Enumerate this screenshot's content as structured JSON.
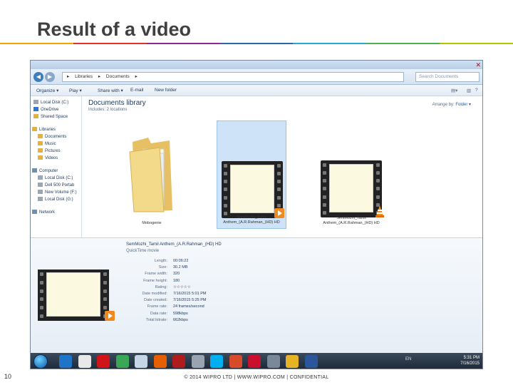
{
  "slide": {
    "title": "Result of a video",
    "page_number": "10",
    "footer": "© 2014 WIPRO LTD | WWW.WIPRO.COM | CONFIDENTIAL",
    "rule_colors": [
      "#f2a600",
      "#e0312b",
      "#8e2a8a",
      "#3064b0",
      "#2aa6d8",
      "#4caf50",
      "#b5c400"
    ]
  },
  "explorer": {
    "address": [
      "Libraries",
      "Documents"
    ],
    "search_placeholder": "Search Documents",
    "toolbar": {
      "organize": "Organize ▾",
      "play": "Play ▾",
      "share": "Share with ▾",
      "email": "E-mail",
      "new_folder": "New folder"
    },
    "nav": [
      {
        "label": "Local Disk (C:)",
        "color": "#9aa6b2"
      },
      {
        "label": "OneDrive",
        "color": "#2a78d0"
      },
      {
        "label": "Shared Space",
        "color": "#e3b13c"
      },
      {
        "label": "Libraries",
        "color": "#e3b13c"
      },
      {
        "label": "Documents",
        "color": "#e3b13c"
      },
      {
        "label": "Music",
        "color": "#e3b13c"
      },
      {
        "label": "Pictures",
        "color": "#e3b13c"
      },
      {
        "label": "Videos",
        "color": "#e3b13c"
      },
      {
        "label": "Computer",
        "color": "#6f8fb3"
      },
      {
        "label": "Local Disk (C:)",
        "color": "#9aa6b2"
      },
      {
        "label": "Dell 500 Portab",
        "color": "#9aa6b2"
      },
      {
        "label": "New Volume (F:)",
        "color": "#9aa6b2"
      },
      {
        "label": "Local Disk (G:)",
        "color": "#9aa6b2"
      },
      {
        "label": "Network",
        "color": "#6f8fb3"
      }
    ],
    "library_title": "Documents library",
    "library_sub": "Includes: 2 locations",
    "arrange_label": "Arrange by:",
    "arrange_value": "Folder ▾",
    "items": [
      {
        "label": "Mobogenie",
        "type": "folder"
      },
      {
        "label": "SeniMozhi_Tamil Anthem_(A.R.Rahman_(HD) HD",
        "type": "video",
        "badge": "play"
      },
      {
        "label": "SeniMozhi_Tamil Anthem_(A.R.Rahman_(HD) HD",
        "type": "video",
        "badge": "vlc"
      }
    ]
  },
  "details": {
    "name": "SemMozhi_Tamil Anthem_(A.R.Rahman_(HD) HD",
    "type": "QuickTime movie",
    "properties": [
      {
        "key": "Length:",
        "value": "00:06:22"
      },
      {
        "key": "Size:",
        "value": "30.2 MB"
      },
      {
        "key": "Frame width:",
        "value": "320"
      },
      {
        "key": "Frame height:",
        "value": "180"
      },
      {
        "key": "Rating:",
        "value": "☆☆☆☆☆"
      },
      {
        "key": "Date modified:",
        "value": "7/16/2015 5:01 PM"
      },
      {
        "key": "Date created:",
        "value": "7/16/2015 5:25 PM"
      },
      {
        "key": "Frame rate:",
        "value": "24 frames/second"
      },
      {
        "key": "Data rate:",
        "value": "598kbps"
      },
      {
        "key": "Total bitrate:",
        "value": "662kbps"
      }
    ]
  },
  "taskbar": {
    "apps": [
      {
        "name": "ie-icon",
        "color": "#1f74c8"
      },
      {
        "name": "media-player-icon",
        "color": "#e8e8e8"
      },
      {
        "name": "opera-icon",
        "color": "#d0141a"
      },
      {
        "name": "chrome-icon",
        "color": "#3aa757"
      },
      {
        "name": "notepad-icon",
        "color": "#c7d6e4"
      },
      {
        "name": "firefox-icon",
        "color": "#e66000"
      },
      {
        "name": "record-icon",
        "color": "#b01c1c"
      },
      {
        "name": "compass-icon",
        "color": "#9aa4b0"
      },
      {
        "name": "skype-icon",
        "color": "#00aff0"
      },
      {
        "name": "paint-icon",
        "color": "#d84b2a"
      },
      {
        "name": "acrobat-icon",
        "color": "#c8102e"
      },
      {
        "name": "resize-icon",
        "color": "#7a8898"
      },
      {
        "name": "chrome-canary-icon",
        "color": "#e6b325"
      },
      {
        "name": "word-icon",
        "color": "#2b579a"
      }
    ],
    "language": "EN",
    "time": "5:31 PM",
    "date": "7/16/2015"
  }
}
